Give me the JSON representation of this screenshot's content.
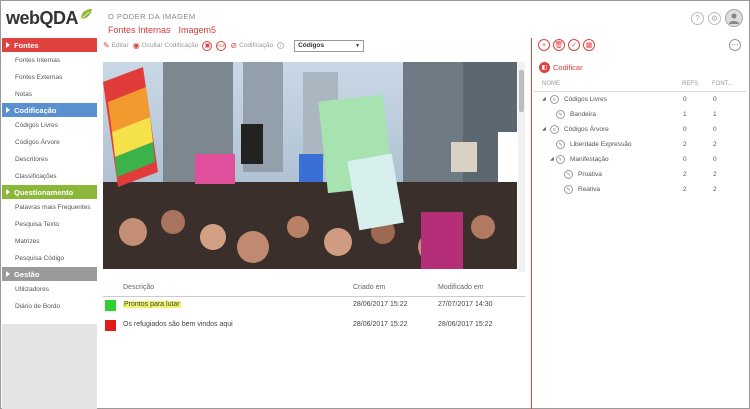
{
  "app": {
    "logo_text": "webQDA"
  },
  "header": {
    "title": "O PODER DA IMAGEM",
    "breadcrumb": [
      "Fontes Internas",
      "Imagem5"
    ]
  },
  "sidebar": {
    "sections": [
      {
        "title": "Fontes",
        "color": "#e0433f",
        "items": [
          "Fontes Internas",
          "Fontes Externas",
          "Notas"
        ]
      },
      {
        "title": "Codificação",
        "color": "#5a8fd0",
        "items": [
          "Códigos Livres",
          "Códigos Árvore",
          "Descritores",
          "Classificações"
        ]
      },
      {
        "title": "Questionamento",
        "color": "#8cb83a",
        "items": [
          "Palavras mais Frequentes",
          "Pesquisa Texto",
          "Matrizes",
          "Pesquisa Código"
        ]
      },
      {
        "title": "Gestão",
        "color": "#9a9a9a",
        "items": [
          "Utilizadores",
          "Diário de Bordo"
        ]
      }
    ]
  },
  "toolbar": {
    "edit_label": "Editar",
    "hide_coding_label": "Ocultar Codificação",
    "coding_label": "Codificação",
    "select_value": "Códigos"
  },
  "table": {
    "columns": [
      "Descrição",
      "Criado em",
      "Modificado em"
    ],
    "rows": [
      {
        "color": "#2fd12f",
        "description": "Prontos para lutar",
        "created": "28/06/2017 15:22",
        "modified": "27/07/2017 14:30"
      },
      {
        "color": "#e01b1b",
        "description": "Os refugiados são bem vindos aqui",
        "created": "28/06/2017 15:22",
        "modified": "28/06/2017 15:22"
      }
    ]
  },
  "right_panel": {
    "codificar_label": "Codificar",
    "columns": {
      "name": "NOME",
      "refs": "REFS",
      "fonts": "FONT..."
    },
    "nodes": [
      {
        "label": "Códigos Livres",
        "refs": "0",
        "fonts": "0",
        "level": 0
      },
      {
        "label": "Bandeira",
        "refs": "1",
        "fonts": "1",
        "level": 1
      },
      {
        "label": "Códigos Árvore",
        "refs": "0",
        "fonts": "0",
        "level": 0
      },
      {
        "label": "Liberdade Expressão",
        "refs": "2",
        "fonts": "2",
        "level": 1
      },
      {
        "label": "Manifestação",
        "refs": "0",
        "fonts": "0",
        "level": 1
      },
      {
        "label": "Proativa",
        "refs": "2",
        "fonts": "2",
        "level": 2
      },
      {
        "label": "Reativa",
        "refs": "2",
        "fonts": "2",
        "level": 2
      }
    ]
  }
}
